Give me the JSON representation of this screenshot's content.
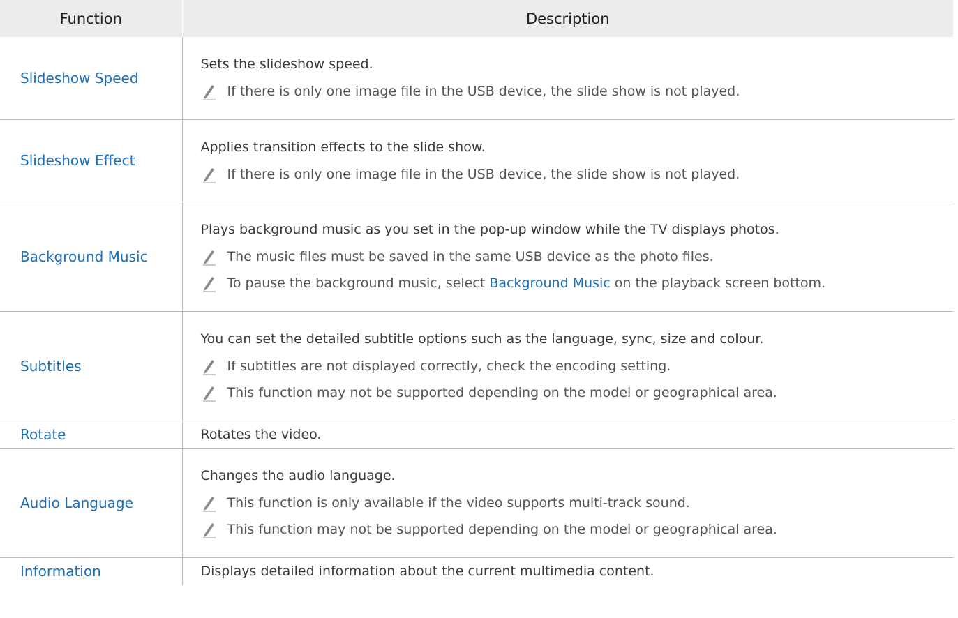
{
  "header": {
    "function": "Function",
    "description": "Description"
  },
  "rows": [
    {
      "function": "Slideshow Speed",
      "description": "Sets the slideshow speed.",
      "notes": [
        "If there is only one image file in the USB device, the slide show is not played."
      ]
    },
    {
      "function": "Slideshow Effect",
      "description": "Applies transition effects to the slide show.",
      "notes": [
        "If there is only one image file in the USB device, the slide show is not played."
      ]
    },
    {
      "function": "Background Music",
      "description": "Plays background music as you set in the pop-up window while the TV displays photos.",
      "notes": [
        "The music files must be saved in the same USB device as the photo files.",
        {
          "before": "To pause the background music, select ",
          "highlight": "Background Music",
          "after": " on the playback screen bottom."
        }
      ]
    },
    {
      "function": "Subtitles",
      "description": "You can set the detailed subtitle options such as the language, sync, size and colour.",
      "notes": [
        "If subtitles are not displayed correctly, check the encoding setting.",
        "This function may not be supported depending on the model or geographical area."
      ]
    },
    {
      "function": "Rotate",
      "description": "Rotates the video.",
      "notes": []
    },
    {
      "function": "Audio Language",
      "description": "Changes the audio language.",
      "notes": [
        "This function is only available if the video supports multi-track sound.",
        "This function may not be supported depending on the model or geographical area."
      ]
    },
    {
      "function": "Information",
      "description": "Displays detailed information about the current multimedia content.",
      "notes": []
    }
  ],
  "icons": {
    "note": "pencil-note-icon"
  },
  "colors": {
    "link": "#1c6fb8",
    "header_bg": "#ececec",
    "border": "#b9b9b9"
  }
}
